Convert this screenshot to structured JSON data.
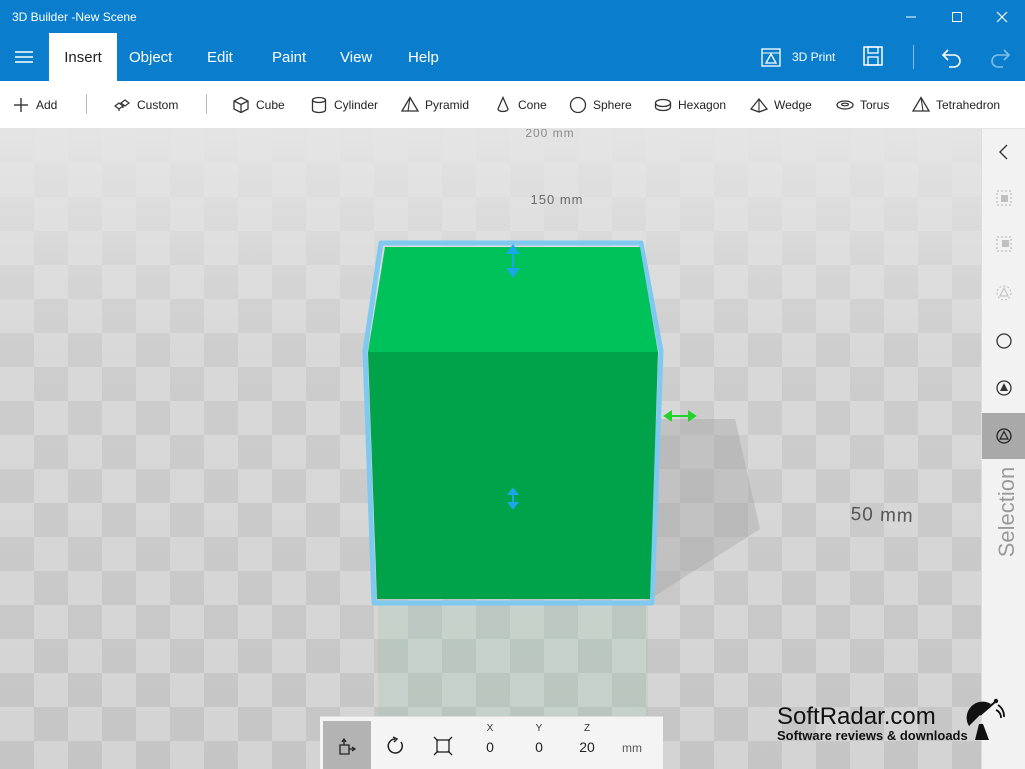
{
  "window": {
    "title": "3D Builder -New Scene",
    "minimize_icon": "minimize-icon",
    "maximize_icon": "maximize-icon",
    "close_icon": "close-icon"
  },
  "menu": {
    "hamburger_icon": "hamburger-menu-icon",
    "tabs": [
      {
        "label": "Insert",
        "active": true
      },
      {
        "label": "Object",
        "active": false
      },
      {
        "label": "Edit",
        "active": false
      },
      {
        "label": "Paint",
        "active": false
      },
      {
        "label": "View",
        "active": false
      },
      {
        "label": "Help",
        "active": false
      }
    ],
    "print_label": "3D Print"
  },
  "toolbar": {
    "add_label": "Add",
    "custom_label": "Custom",
    "shapes": [
      {
        "label": "Cube",
        "icon": "cube-icon"
      },
      {
        "label": "Cylinder",
        "icon": "cylinder-icon"
      },
      {
        "label": "Pyramid",
        "icon": "pyramid-icon"
      },
      {
        "label": "Cone",
        "icon": "cone-icon"
      },
      {
        "label": "Sphere",
        "icon": "sphere-icon"
      },
      {
        "label": "Hexagon",
        "icon": "hexagon-icon"
      },
      {
        "label": "Wedge",
        "icon": "wedge-icon"
      },
      {
        "label": "Torus",
        "icon": "torus-icon"
      },
      {
        "label": "Tetrahedron",
        "icon": "tetrahedron-icon"
      }
    ]
  },
  "scene": {
    "ruler_labels": [
      "200 mm",
      "150 mm",
      "50 mm"
    ],
    "object_color": "#00a34a"
  },
  "right_panel": {
    "label": "Selection"
  },
  "transform": {
    "x_label": "X",
    "x_value": "0",
    "y_label": "Y",
    "y_value": "0",
    "z_label": "Z",
    "z_value": "20",
    "unit": "mm"
  },
  "watermark": {
    "name": "SoftRadar.com",
    "tagline": "Software reviews & downloads"
  },
  "colors": {
    "accent": "#0a7ecd",
    "handle": "#1aa7e6",
    "scale_handle": "#22d42a"
  }
}
